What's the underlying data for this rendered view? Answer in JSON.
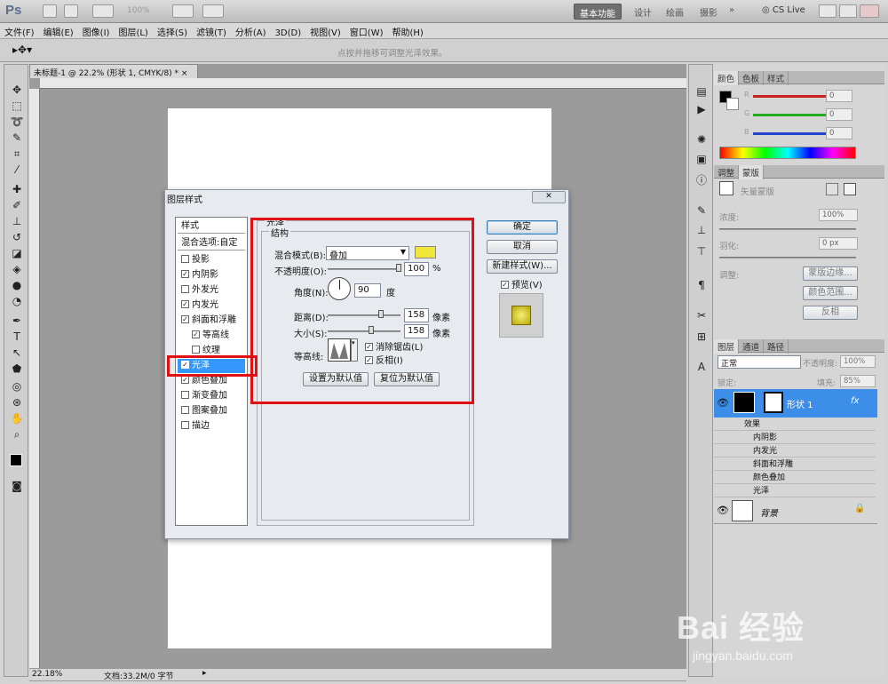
{
  "app": {
    "logo": "Ps",
    "zoom_hint": "100%",
    "workspaces": [
      "基本功能",
      "设计",
      "绘画",
      "摄影"
    ],
    "cs_live": "CS Live"
  },
  "menu": [
    "文件(F)",
    "编辑(E)",
    "图像(I)",
    "图层(L)",
    "选择(S)",
    "滤镜(T)",
    "分析(A)",
    "3D(D)",
    "视图(V)",
    "窗口(W)",
    "帮助(H)"
  ],
  "options_bar": {
    "hint": "点按并拖移可调整光泽效果。"
  },
  "document": {
    "tab_title": "未标题-1 @ 22.2% (形状 1, CMYK/8) *",
    "ruler_marks": [
      "60",
      "50",
      "40",
      "30",
      "20",
      "10",
      "0",
      "10",
      "20",
      "30",
      "40",
      "50",
      "60",
      "70",
      "80",
      "90",
      "100",
      "110",
      "120",
      "130",
      "140",
      "150",
      "160"
    ],
    "status_zoom": "22.18%",
    "status_doc": "文档:33.2M/0 字节"
  },
  "color_panel": {
    "tabs": [
      "颜色",
      "色板",
      "样式"
    ],
    "channels": [
      {
        "label": "R",
        "value": "0",
        "color": "#cc2222"
      },
      {
        "label": "G",
        "value": "0",
        "color": "#22aa22"
      },
      {
        "label": "B",
        "value": "0",
        "color": "#2244cc"
      }
    ]
  },
  "mask_panel": {
    "tabs": [
      "调整",
      "蒙版"
    ],
    "title": "矢量蒙版",
    "density_label": "浓度:",
    "density_value": "100%",
    "feather_label": "羽化:",
    "feather_value": "0 px",
    "refine_label": "调整:",
    "buttons": [
      "蒙版边缘...",
      "颜色范围...",
      "反相"
    ]
  },
  "layers_panel": {
    "tabs": [
      "图层",
      "通道",
      "路径"
    ],
    "blend_mode": "正常",
    "opacity_label": "不透明度:",
    "opacity_value": "100%",
    "lock_label": "锁定:",
    "fill_label": "填充:",
    "fill_value": "85%",
    "layer_name": "形状 1",
    "fx": "fx",
    "effects_label": "效果",
    "effects": [
      "内阴影",
      "内发光",
      "斜面和浮雕",
      "颜色叠加",
      "光泽"
    ],
    "background_name": "背景"
  },
  "dialog": {
    "title": "图层样式",
    "styles_header": "样式",
    "blend_options": "混合选项:自定",
    "styles": [
      {
        "label": "投影",
        "checked": false,
        "sub": false
      },
      {
        "label": "内阴影",
        "checked": true,
        "sub": false
      },
      {
        "label": "外发光",
        "checked": false,
        "sub": false
      },
      {
        "label": "内发光",
        "checked": true,
        "sub": false
      },
      {
        "label": "斜面和浮雕",
        "checked": true,
        "sub": false
      },
      {
        "label": "等高线",
        "checked": true,
        "sub": true
      },
      {
        "label": "纹理",
        "checked": false,
        "sub": true
      },
      {
        "label": "光泽",
        "checked": true,
        "sub": false,
        "selected": true
      },
      {
        "label": "颜色叠加",
        "checked": true,
        "sub": false
      },
      {
        "label": "渐变叠加",
        "checked": false,
        "sub": false
      },
      {
        "label": "图案叠加",
        "checked": false,
        "sub": false
      },
      {
        "label": "描边",
        "checked": false,
        "sub": false
      }
    ],
    "satin": {
      "section": "光泽",
      "structure": "结构",
      "blend_label": "混合模式(B):",
      "blend_value": "叠加",
      "swatch_color": "#f0e63a",
      "opacity_label": "不透明度(O):",
      "opacity_value": "100",
      "percent": "%",
      "angle_label": "角度(N):",
      "angle_value": "90",
      "angle_unit": "度",
      "distance_label": "距离(D):",
      "distance_value": "158",
      "size_label": "大小(S):",
      "size_value": "158",
      "px_unit": "像素",
      "contour_label": "等高线:",
      "antialias_label": "消除锯齿(L)",
      "invert_label": "反相(I)",
      "set_default": "设置为默认值",
      "reset_default": "复位为默认值"
    },
    "buttons": {
      "ok": "确定",
      "cancel": "取消",
      "new_style": "新建样式(W)...",
      "preview": "预览(V)"
    }
  },
  "watermark": {
    "brand": "Bai 经验",
    "url": "jingyan.baidu.com"
  }
}
